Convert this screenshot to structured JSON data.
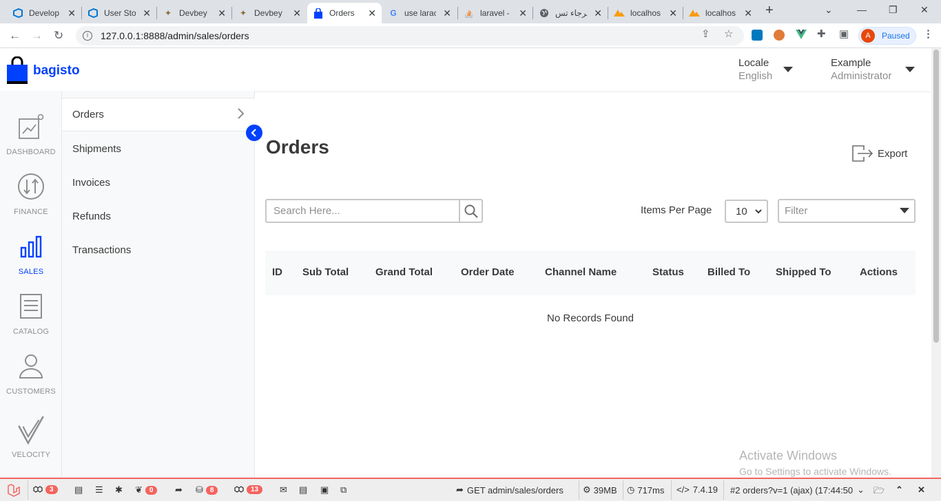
{
  "browser": {
    "tabs": [
      {
        "title": "Develop",
        "icon": "azure-devops-icon",
        "active": false
      },
      {
        "title": "User Sto",
        "icon": "azure-devops-icon",
        "active": false
      },
      {
        "title": "Devbey",
        "icon": "devbey-icon",
        "active": false
      },
      {
        "title": "Devbey",
        "icon": "devbey-icon",
        "active": false
      },
      {
        "title": "Orders",
        "icon": "bagisto-bag-icon",
        "active": true
      },
      {
        "title": "use larac",
        "icon": "google-icon",
        "active": false
      },
      {
        "title": "laravel -",
        "icon": "stackoverflow-icon",
        "active": false
      },
      {
        "title": "الرجاء تس",
        "icon": "globe-icon",
        "active": false
      },
      {
        "title": "localhos",
        "icon": "phpmyadmin-icon",
        "active": false
      },
      {
        "title": "localhos",
        "icon": "phpmyadmin-icon",
        "active": false
      }
    ],
    "url": "127.0.0.1:8888/admin/sales/orders",
    "profile_initial": "A",
    "profile_status": "Paused"
  },
  "header": {
    "logo": "bagisto",
    "locale_label": "Locale",
    "locale_value": "English",
    "user_name": "Example",
    "user_role": "Administrator"
  },
  "iconnav": [
    {
      "label": "DASHBOARD",
      "icon": "dashboard-icon",
      "active": false
    },
    {
      "label": "FINANCE",
      "icon": "finance-icon",
      "active": false
    },
    {
      "label": "SALES",
      "icon": "sales-icon",
      "active": true
    },
    {
      "label": "CATALOG",
      "icon": "catalog-icon",
      "active": false
    },
    {
      "label": "CUSTOMERS",
      "icon": "customers-icon",
      "active": false
    },
    {
      "label": "VELOCITY",
      "icon": "velocity-icon",
      "active": false
    }
  ],
  "submenu": [
    {
      "label": "Orders",
      "active": true
    },
    {
      "label": "Shipments",
      "active": false
    },
    {
      "label": "Invoices",
      "active": false
    },
    {
      "label": "Refunds",
      "active": false
    },
    {
      "label": "Transactions",
      "active": false
    }
  ],
  "main": {
    "title": "Orders",
    "export_label": "Export",
    "search_placeholder": "Search Here...",
    "items_per_page_label": "Items Per Page",
    "items_per_page_value": "10",
    "filter_placeholder": "Filter",
    "columns": [
      "ID",
      "Sub Total",
      "Grand Total",
      "Order Date",
      "Channel Name",
      "Status",
      "Billed To",
      "Shipped To",
      "Actions"
    ],
    "empty_text": "No Records Found"
  },
  "watermark": {
    "line1": "Activate Windows",
    "line2": "Go to Settings to activate Windows."
  },
  "debugbar": {
    "count_a": "3",
    "count_b": "0",
    "count_c": "8",
    "count_d": "13",
    "request": "GET admin/sales/orders",
    "memory": "39MB",
    "time": "717ms",
    "php_version": "7.4.19",
    "ajax_request": "#2 orders?v=1 (ajax) (17:44:50"
  },
  "colors": {
    "brand": "#0041ff",
    "debug_accent": "#f4645f"
  }
}
